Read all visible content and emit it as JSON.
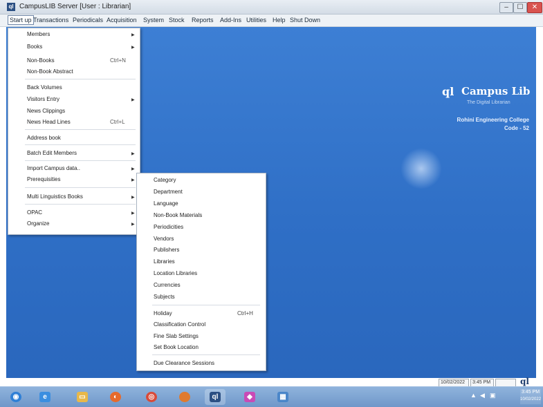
{
  "window": {
    "title": "CampusLIB Server [User : Librarian]",
    "app_icon": "ql",
    "controls": {
      "minimize": "–",
      "maximize": "☐",
      "close": "✕"
    }
  },
  "menubar": {
    "items": [
      "Start up",
      "Transactions",
      "Periodicals",
      "Acquisition",
      "System",
      "Stock",
      "Reports",
      "Add-Ins",
      "Utilities",
      "Help",
      "Shut Down"
    ]
  },
  "startup_menu": {
    "items": [
      {
        "label": "Members",
        "shortcut": "",
        "submenu": true
      },
      {
        "label": "Books",
        "shortcut": "",
        "submenu": true
      },
      {
        "label": "Non-Books",
        "shortcut": "Ctrl+N",
        "submenu": false
      },
      {
        "label": "Non-Book Abstract",
        "shortcut": "",
        "submenu": false
      },
      {
        "label": "Back Volumes",
        "shortcut": "",
        "submenu": false
      },
      {
        "label": "Visitors Entry",
        "shortcut": "",
        "submenu": true
      },
      {
        "label": "News Clippings",
        "shortcut": "",
        "submenu": false
      },
      {
        "label": "News Head Lines",
        "shortcut": "Ctrl+L",
        "submenu": false
      },
      {
        "label": "Address book",
        "shortcut": "",
        "submenu": false
      },
      {
        "label": "Batch Edit Members",
        "shortcut": "",
        "submenu": true
      },
      {
        "label": "Import Campus data..",
        "shortcut": "",
        "submenu": true
      },
      {
        "label": "Prerequisities",
        "shortcut": "",
        "submenu": true
      },
      {
        "label": "Multi Linguistics Books",
        "shortcut": "",
        "submenu": true
      },
      {
        "label": "OPAC",
        "shortcut": "",
        "submenu": true
      },
      {
        "label": "Organize",
        "shortcut": "",
        "submenu": true
      }
    ],
    "arrow": "▶"
  },
  "prerequisites_submenu": {
    "items": [
      {
        "label": "Category",
        "shortcut": ""
      },
      {
        "label": "Department",
        "shortcut": ""
      },
      {
        "label": "Language",
        "shortcut": ""
      },
      {
        "label": "Non-Book Materials",
        "shortcut": ""
      },
      {
        "label": "Periodicities",
        "shortcut": ""
      },
      {
        "label": "Vendors",
        "shortcut": ""
      },
      {
        "label": "Publishers",
        "shortcut": ""
      },
      {
        "label": "Libraries",
        "shortcut": ""
      },
      {
        "label": "Location Libraries",
        "shortcut": ""
      },
      {
        "label": "Currencies",
        "shortcut": ""
      },
      {
        "label": "Subjects",
        "shortcut": ""
      },
      {
        "label": "Holiday",
        "shortcut": "Ctrl+H"
      },
      {
        "label": "Classification Control",
        "shortcut": ""
      },
      {
        "label": "Fine Slab Settings",
        "shortcut": ""
      },
      {
        "label": "Set Book Location",
        "shortcut": ""
      },
      {
        "label": "Due Clearance Sessions",
        "shortcut": ""
      }
    ]
  },
  "branding": {
    "mark": "ql",
    "name": "Campus Lib",
    "tagline": "The Digital Librarian",
    "college": "Rohini Engineering College",
    "code": "Code - 52"
  },
  "status": {
    "date": "10/02/2022",
    "time": "3:45 PM",
    "logo": "ql"
  },
  "taskbar": {
    "icons": [
      {
        "name": "start-orb-icon",
        "glyph": "◉",
        "color": "#2e7fd6"
      },
      {
        "name": "internet-explorer-icon",
        "glyph": "e",
        "color": "#3b8ee0"
      },
      {
        "name": "folder-icon",
        "glyph": "▭",
        "color": "#e8b84a"
      },
      {
        "name": "firefox-icon",
        "glyph": "◐",
        "color": "#e66a2c"
      },
      {
        "name": "chrome-icon",
        "glyph": "◎",
        "color": "#d84b3a"
      },
      {
        "name": "campuslib-icon",
        "glyph": "ql",
        "color": "#2b4f83"
      },
      {
        "name": "app-diamond-icon",
        "glyph": "◆",
        "color": "#c94bb6"
      },
      {
        "name": "app-window-icon",
        "glyph": "▦",
        "color": "#4a86c9"
      }
    ],
    "tray": [
      "▲",
      "◀",
      "▣"
    ],
    "clock_time": "3:45 PM",
    "clock_date": "10/02/2022"
  }
}
